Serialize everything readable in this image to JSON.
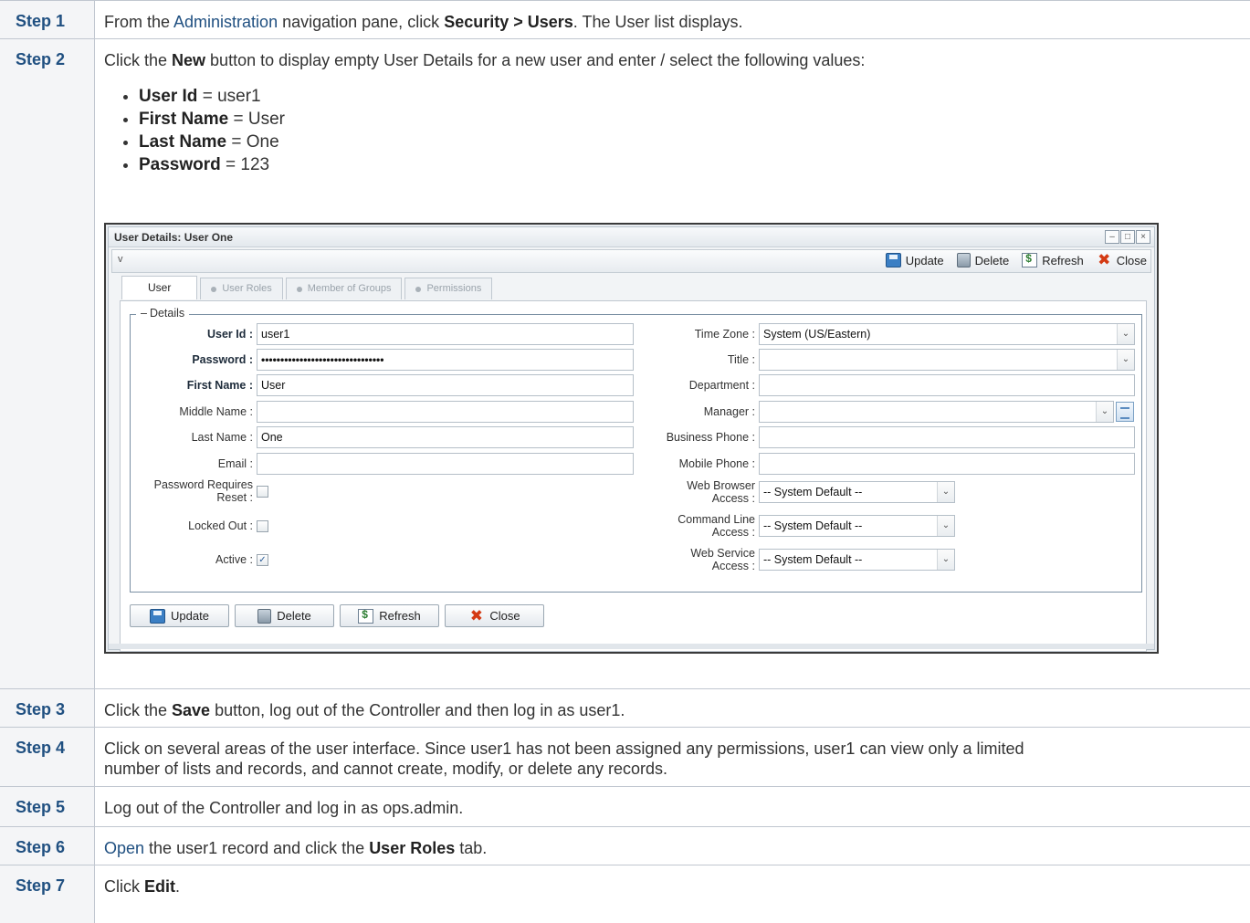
{
  "steps": [
    {
      "label": "Step 1",
      "link": "Administration",
      "pre": "From the ",
      "mid": " navigation pane, click ",
      "bold": "Security > Users",
      "post": ". The User list displays."
    },
    {
      "label": "Step 2",
      "pre": "Click the ",
      "bold": "New",
      "post": " button to display empty User Details for a new user and enter / select the following values:",
      "values": [
        {
          "key": "User Id",
          "val": " = user1"
        },
        {
          "key": "First Name",
          "val": " = User"
        },
        {
          "key": "Last Name",
          "val": " = One"
        },
        {
          "key": "Password",
          "val": " = 123"
        }
      ]
    },
    {
      "label": "Step 3",
      "pre": "Click the ",
      "bold": "Save",
      "post": " button, log out of the Controller and then log in as user1."
    },
    {
      "label": "Step 4",
      "text1": "Click on several areas of the user interface. Since user1 has not been assigned any permissions, user1 can view only a limited",
      "text2": "number of lists and records, and cannot create, modify, or delete any records."
    },
    {
      "label": "Step 5",
      "text": "Log out of the Controller and log in as ops.admin."
    },
    {
      "label": "Step 6",
      "link": "Open",
      "mid": " the user1 record and click the ",
      "bold": "User Roles",
      "post": " tab."
    },
    {
      "label": "Step 7",
      "pre": "Click ",
      "bold": "Edit",
      "post": "."
    }
  ],
  "window": {
    "title": "User Details: User One",
    "controls": [
      "–",
      "□",
      "×"
    ],
    "caret": "v",
    "toolbar": {
      "update": "Update",
      "delete": "Delete",
      "refresh": "Refresh",
      "close": "Close"
    },
    "tabs": {
      "user": "User",
      "user_roles": "User Roles",
      "member_of_groups": "Member of Groups",
      "permissions": "Permissions"
    },
    "details_legend": "Details",
    "left_fields": {
      "user_id": {
        "label": "User Id :",
        "value": "user1"
      },
      "password": {
        "label": "Password :",
        "value": "••••••••••••••••••••••••••••••••"
      },
      "first_name": {
        "label": "First Name :",
        "value": "User"
      },
      "middle_name": {
        "label": "Middle Name :",
        "value": ""
      },
      "last_name": {
        "label": "Last Name :",
        "value": "One"
      },
      "email": {
        "label": "Email :",
        "value": ""
      },
      "password_reset": {
        "label1": "Password Requires",
        "label2": "Reset :",
        "checked": false
      },
      "locked_out": {
        "label": "Locked Out :",
        "checked": false
      },
      "active": {
        "label": "Active :",
        "checked": true,
        "mark": "✓"
      }
    },
    "right_fields": {
      "time_zone": {
        "label": "Time Zone :",
        "value": "System (US/Eastern)"
      },
      "title": {
        "label": "Title :",
        "value": ""
      },
      "department": {
        "label": "Department :",
        "value": ""
      },
      "manager": {
        "label": "Manager :",
        "value": ""
      },
      "business_phone": {
        "label": "Business Phone :",
        "value": ""
      },
      "mobile_phone": {
        "label": "Mobile Phone :",
        "value": ""
      },
      "web_browser_access": {
        "label1": "Web Browser",
        "label2": "Access :",
        "value": "-- System Default --"
      },
      "command_line_access": {
        "label1": "Command Line",
        "label2": "Access :",
        "value": "-- System Default --"
      },
      "web_service_access": {
        "label1": "Web Service",
        "label2": "Access :",
        "value": "-- System Default --"
      }
    },
    "buttons": {
      "update": "Update",
      "delete": "Delete",
      "refresh": "Refresh",
      "close": "Close"
    },
    "select_arrow": "⌄"
  }
}
